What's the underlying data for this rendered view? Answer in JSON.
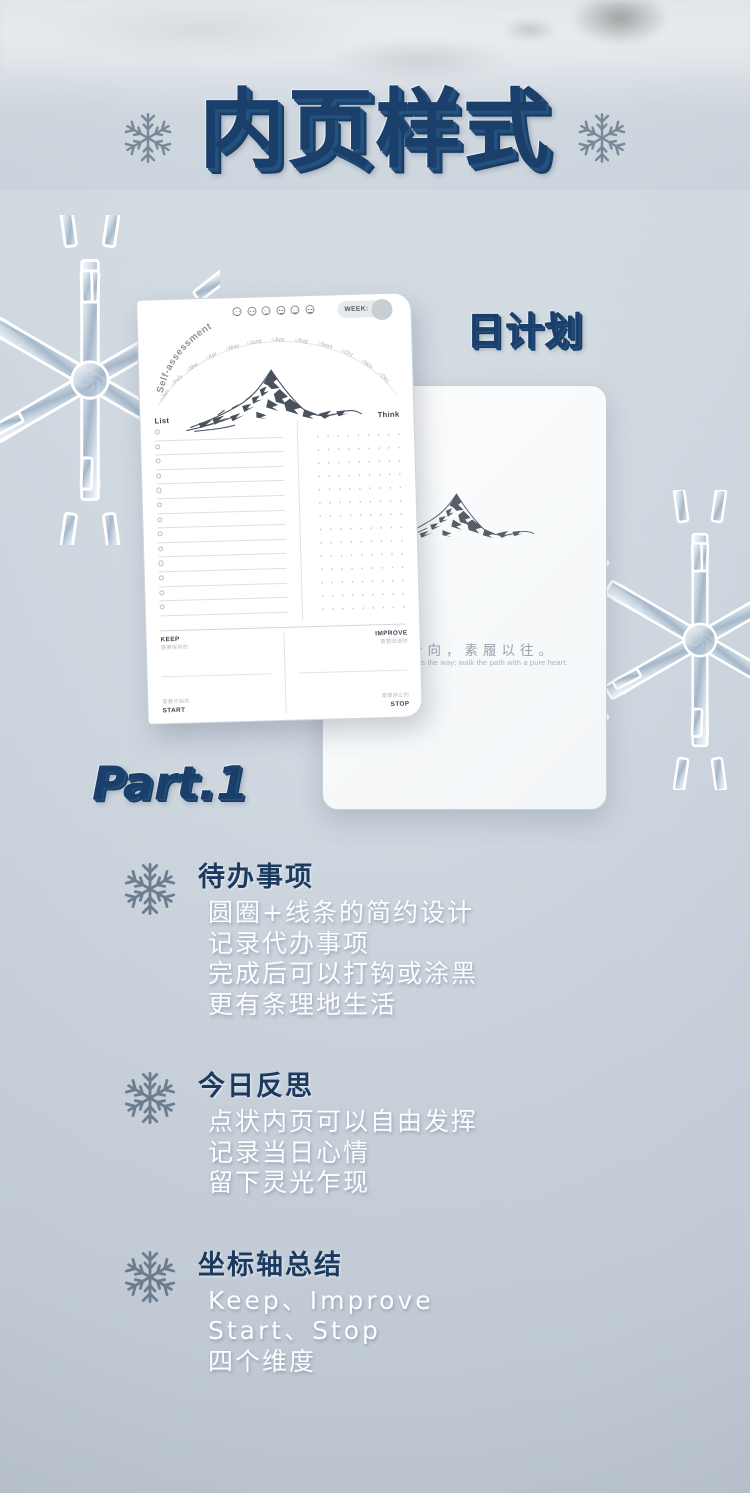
{
  "header": {
    "title": "内页样式",
    "flake_left_icon": "snowflake-icon",
    "flake_right_icon": "snowflake-icon"
  },
  "labels": {
    "daily_plan": "日计划",
    "part": "Part.1"
  },
  "notebook_front": {
    "self_assessment_label": "Self-assessment",
    "months": [
      "Jan",
      "Feb",
      "Mar",
      "Apr",
      "May",
      "June",
      "July",
      "Aug",
      "Sept",
      "Oct",
      "Nov",
      "Dec"
    ],
    "mood_faces": [
      "face-grin",
      "face-smile",
      "face-neutral",
      "face-frown",
      "face-sad",
      "face-dizzy"
    ],
    "week_label": "WEEK:",
    "list_heading": "List",
    "think_heading": "Think",
    "list_rows": 13,
    "quadrants": [
      {
        "label": "KEEP",
        "sub": "需要保持的",
        "align": "left"
      },
      {
        "label": "IMPROVE",
        "sub": "需要改进的",
        "align": "right"
      },
      {
        "label": "START",
        "sub": "需要开始的",
        "align": "left"
      },
      {
        "label": "STOP",
        "sub": "需要停止的",
        "align": "right"
      }
    ],
    "mountain_icon": "mountain-sketch-icon"
  },
  "notebook_back": {
    "quote_cn": "心之所向，素履以往。",
    "quote_en": "Where the heart is the way; walk the path with a pure heart.",
    "mountain_icon": "mountain-sketch-icon"
  },
  "features": [
    {
      "icon": "snowflake-icon",
      "title": "待办事项",
      "lines": [
        "圆圈+线条的简约设计",
        "记录代办事项",
        "完成后可以打钩或涂黑",
        "更有条理地生活"
      ]
    },
    {
      "icon": "snowflake-icon",
      "title": "今日反思",
      "lines": [
        "点状内页可以自由发挥",
        "记录当日心情",
        "留下灵光乍现"
      ]
    },
    {
      "icon": "snowflake-icon",
      "title": "坐标轴总结",
      "lines": [
        "Keep、Improve",
        "Start、Stop",
        "四个维度"
      ]
    }
  ],
  "colors": {
    "navy": "#1b3f6b",
    "background": "#ccd5de",
    "card": "#ffffff",
    "muted_text": "#9aa4b0"
  }
}
